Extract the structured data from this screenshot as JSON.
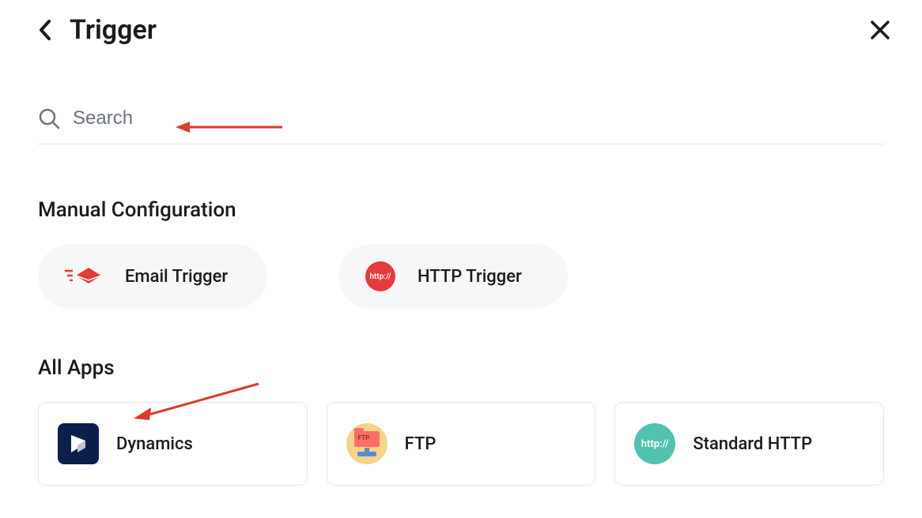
{
  "header": {
    "title": "Trigger"
  },
  "search": {
    "placeholder": "Search"
  },
  "manual": {
    "title": "Manual Configuration",
    "items": [
      {
        "label": "Email Trigger",
        "icon": "email-trigger-icon"
      },
      {
        "label": "HTTP Trigger",
        "icon": "http-trigger-icon",
        "icon_text": "http://"
      }
    ]
  },
  "allApps": {
    "title": "All Apps",
    "items": [
      {
        "label": "Dynamics",
        "icon": "dynamics-icon"
      },
      {
        "label": "FTP",
        "icon": "ftp-icon",
        "icon_text": "FTP"
      },
      {
        "label": "Standard HTTP",
        "icon": "standard-http-icon",
        "icon_text": "http://"
      }
    ]
  },
  "colors": {
    "accent_red": "#e43b3b",
    "teal": "#51c2b0",
    "dynamics_navy": "#0b1f4d",
    "annotation": "#de3a2b"
  }
}
